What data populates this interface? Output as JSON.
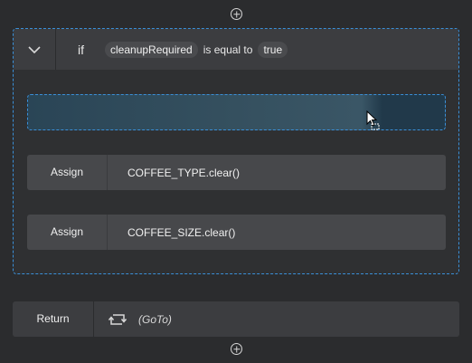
{
  "if_block": {
    "keyword": "if",
    "variable": "cleanupRequired",
    "operator": "is equal to",
    "value": "true"
  },
  "statements": [
    {
      "label": "Assign",
      "value": "COFFEE_TYPE.clear()"
    },
    {
      "label": "Assign",
      "value": "COFFEE_SIZE.clear()"
    }
  ],
  "return_block": {
    "label": "Return",
    "target": "(GoTo)"
  },
  "colors": {
    "background": "#2b2c2e",
    "accent": "#3a8fd8",
    "row": "#47484b"
  }
}
